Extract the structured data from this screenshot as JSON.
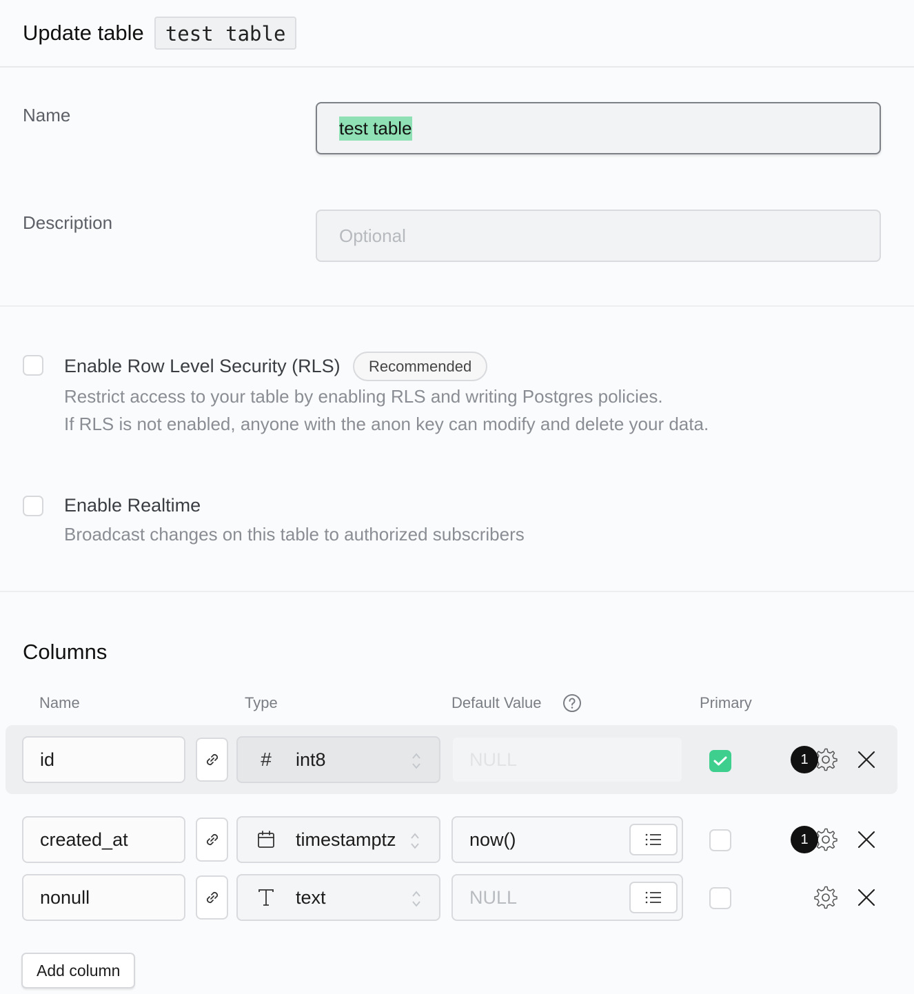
{
  "header": {
    "title": "Update table",
    "table_name": "test table"
  },
  "form": {
    "name_label": "Name",
    "name_value": "test table",
    "description_label": "Description",
    "description_placeholder": "Optional"
  },
  "rls": {
    "title": "Enable Row Level Security (RLS)",
    "badge": "Recommended",
    "desc_line1": "Restrict access to your table by enabling RLS and writing Postgres policies.",
    "desc_line2": "If RLS is not enabled, anyone with the anon key can modify and delete your data.",
    "checked": false
  },
  "realtime": {
    "title": "Enable Realtime",
    "desc": "Broadcast changes on this table to authorized subscribers",
    "checked": false
  },
  "columns": {
    "title": "Columns",
    "headers": {
      "name": "Name",
      "type": "Type",
      "default": "Default Value",
      "primary": "Primary"
    },
    "rows": [
      {
        "name": "id",
        "type": "int8",
        "type_icon": "hash-icon",
        "default": "NULL",
        "primary": true,
        "badge": "1"
      },
      {
        "name": "created_at",
        "type": "timestamptz",
        "type_icon": "calendar-icon",
        "default": "now()",
        "primary": false,
        "badge": "1"
      },
      {
        "name": "nonull",
        "type": "text",
        "type_icon": "text-type-icon",
        "default": "NULL",
        "primary": false,
        "badge": ""
      }
    ],
    "add_label": "Add column"
  },
  "colors": {
    "accent": "#3ecf8e",
    "selection": "#8fe0b4"
  }
}
